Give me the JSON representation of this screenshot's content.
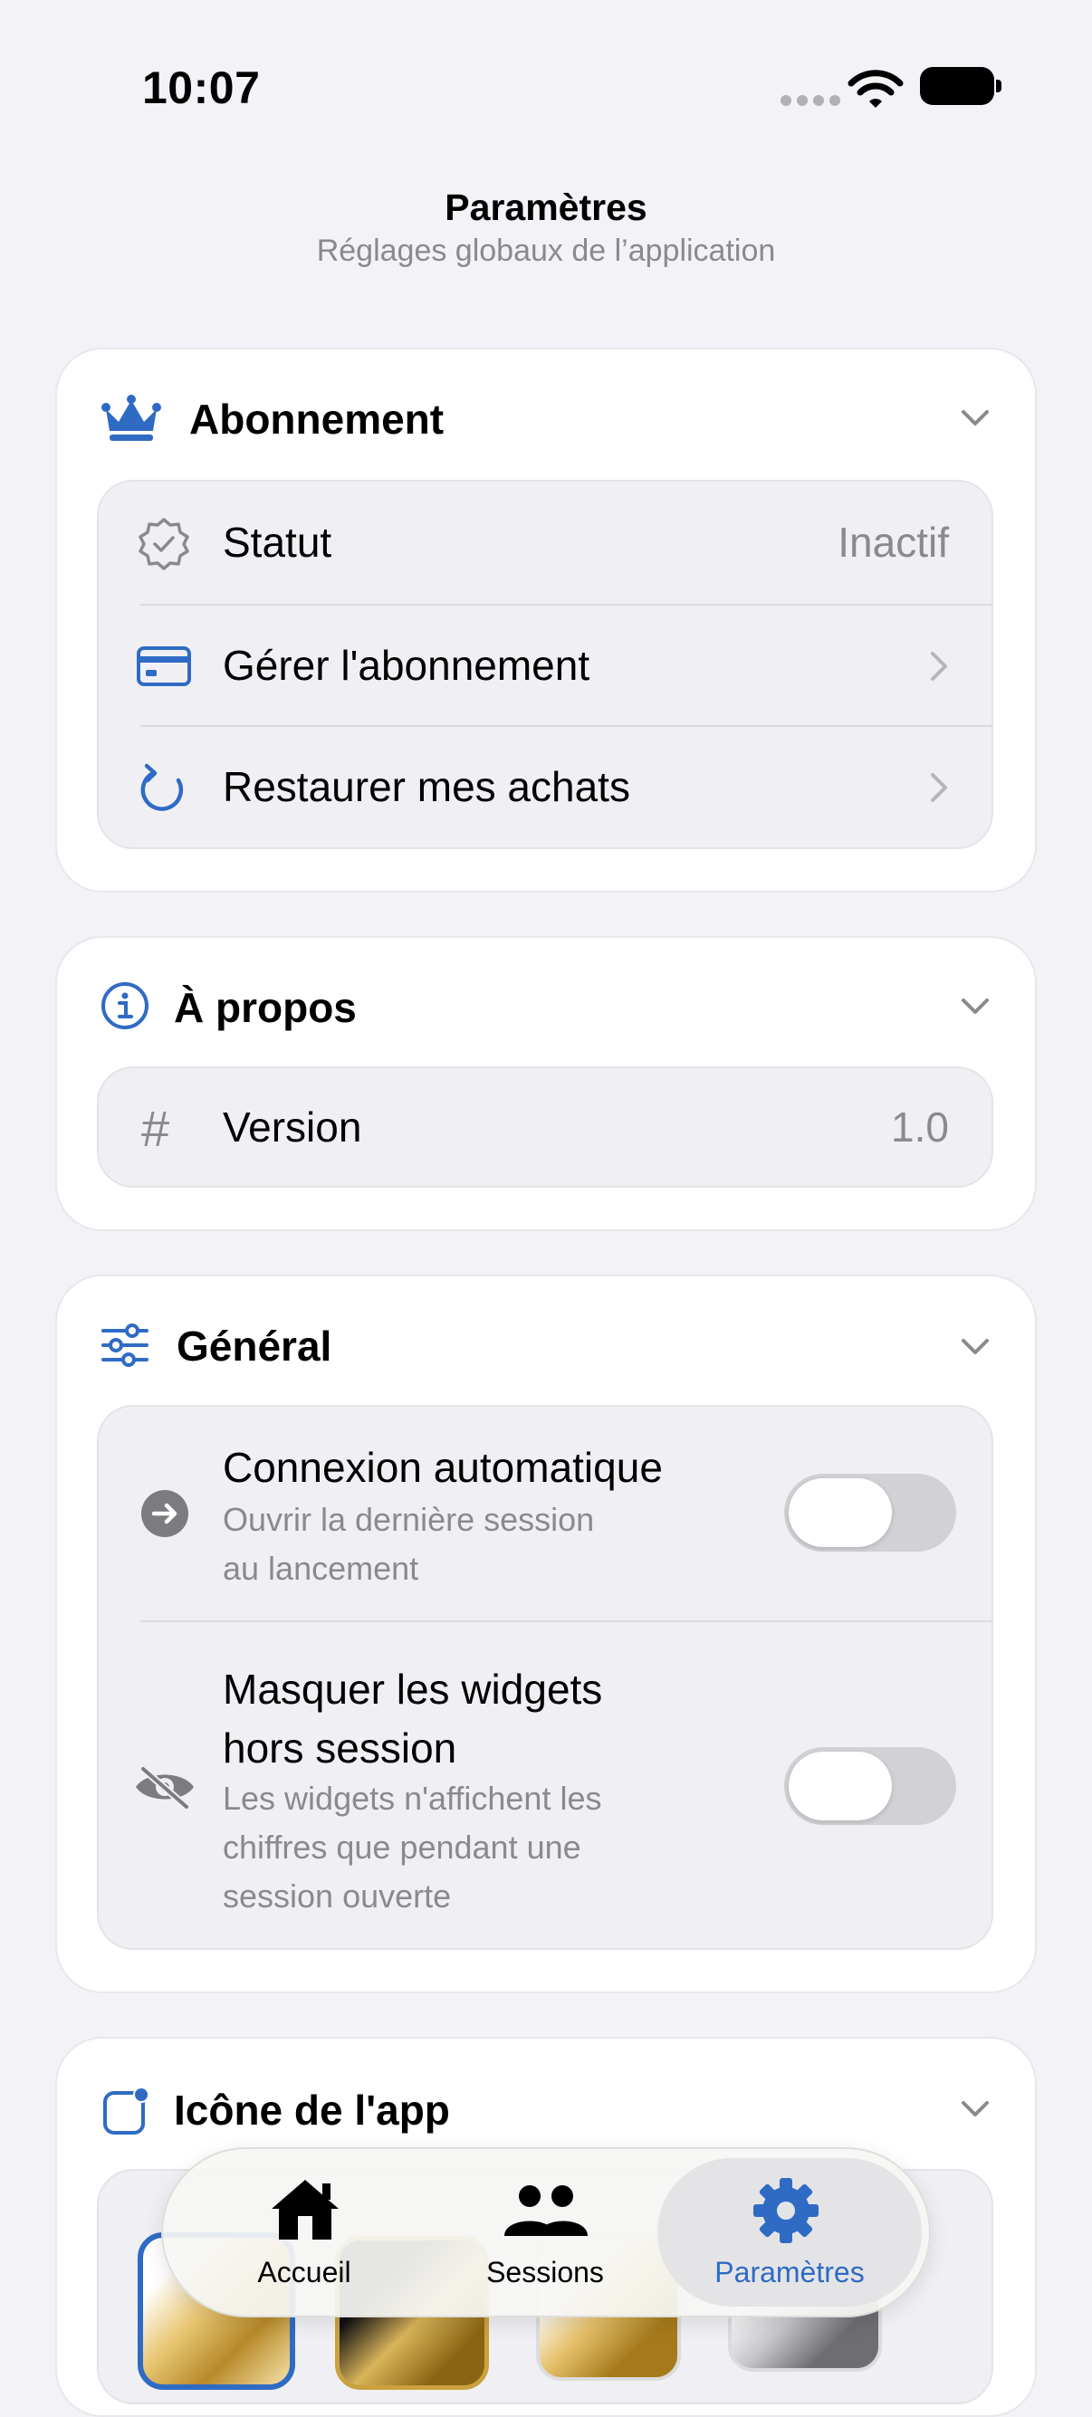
{
  "status_bar": {
    "time": "10:07"
  },
  "header": {
    "title": "Paramètres",
    "subtitle": "Réglages globaux de l’application"
  },
  "sections": {
    "subscription": {
      "title": "Abonnement",
      "rows": {
        "status": {
          "label": "Statut",
          "value": "Inactif"
        },
        "manage": {
          "label": "Gérer l'abonnement"
        },
        "restore": {
          "label": "Restaurer mes achats"
        }
      }
    },
    "about": {
      "title": "À propos",
      "rows": {
        "version": {
          "label": "Version",
          "value": "1.0"
        }
      }
    },
    "general": {
      "title": "Général",
      "rows": {
        "auto_connect": {
          "label": "Connexion automatique",
          "sub_line1": "Ouvrir la dernière session",
          "sub_line2": "au lancement",
          "enabled": false
        },
        "hide_widgets": {
          "label_line1": "Masquer les widgets",
          "label_line2": "hors session",
          "sub_line1": "Les widgets n'affichent les",
          "sub_line2": "chiffres que pendant une",
          "sub_line3": "session ouverte",
          "enabled": false
        }
      }
    },
    "app_icon": {
      "title": "Icône de l'app"
    }
  },
  "tab_bar": {
    "tabs": [
      {
        "label": "Accueil",
        "icon": "house-icon",
        "active": false
      },
      {
        "label": "Sessions",
        "icon": "people-icon",
        "active": false
      },
      {
        "label": "Paramètres",
        "icon": "gear-icon",
        "active": true
      }
    ]
  },
  "colors": {
    "accent": "#2f6bc4",
    "background": "#f2f2f7",
    "secondary_text": "#8a8a8e"
  }
}
